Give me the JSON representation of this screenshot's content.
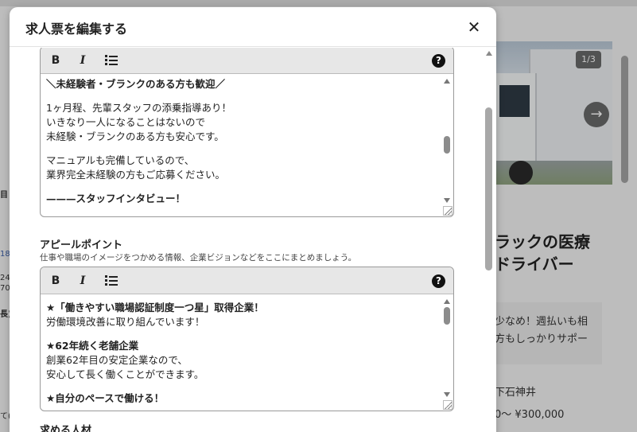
{
  "background": {
    "image_counter": "1/3",
    "next_arrow": "→",
    "title_line1": "ラックの医療",
    "title_line2": "ドライバー",
    "note_line1": "少なめ！週払いも相",
    "note_line2": "方もしっかりサポー",
    "location": "下石神井",
    "salary": "0〜 ¥300,000",
    "left_fragments": [
      "目",
      "18",
      "24-",
      "70",
      "長)",
      "て("
    ]
  },
  "modal": {
    "title": "求人票を編集する",
    "close_glyph": "✕"
  },
  "toolbar": {
    "bold_label": "B",
    "italic_label": "I",
    "help_label": "?"
  },
  "editor1": {
    "lines": [
      {
        "text": "＼未経験者・ブランクのある方も歓迎／",
        "bold": true
      },
      {
        "text": "1ヶ月程、先輩スタッフの添乗指導あり！"
      },
      {
        "text": "いきなり一人になることはないので"
      },
      {
        "text": "未経験・ブランクのある方も安心です。"
      },
      {
        "text": "マニュアルも完備しているので、"
      },
      {
        "text": "業界完全未経験の方もご応募ください。"
      },
      {
        "text": "———スタッフインタビュー！",
        "bold": true
      }
    ]
  },
  "appeal": {
    "label": "アピールポイント",
    "help": "仕事や職場のイメージをつかめる情報、企業ビジョンなどをここにまとめましょう。"
  },
  "editor2": {
    "lines": [
      {
        "text": "★「働きやすい職場認証制度一つ星」取得企業！",
        "bold": true
      },
      {
        "text": "労働環境改善に取り組んでいます！"
      },
      {
        "text": "★62年続く老舗企業",
        "bold": true
      },
      {
        "text": "創業62年目の安定企業なので、"
      },
      {
        "text": "安心して長く働くことができます。"
      },
      {
        "text": "★自分のペースで働ける！",
        "bold": true
      }
    ]
  },
  "requirements": {
    "label": "求める人材"
  },
  "colors": {
    "overlay": "#000000",
    "toolbar_bg": "#e7e7e7",
    "border": "#9a9a9a"
  }
}
